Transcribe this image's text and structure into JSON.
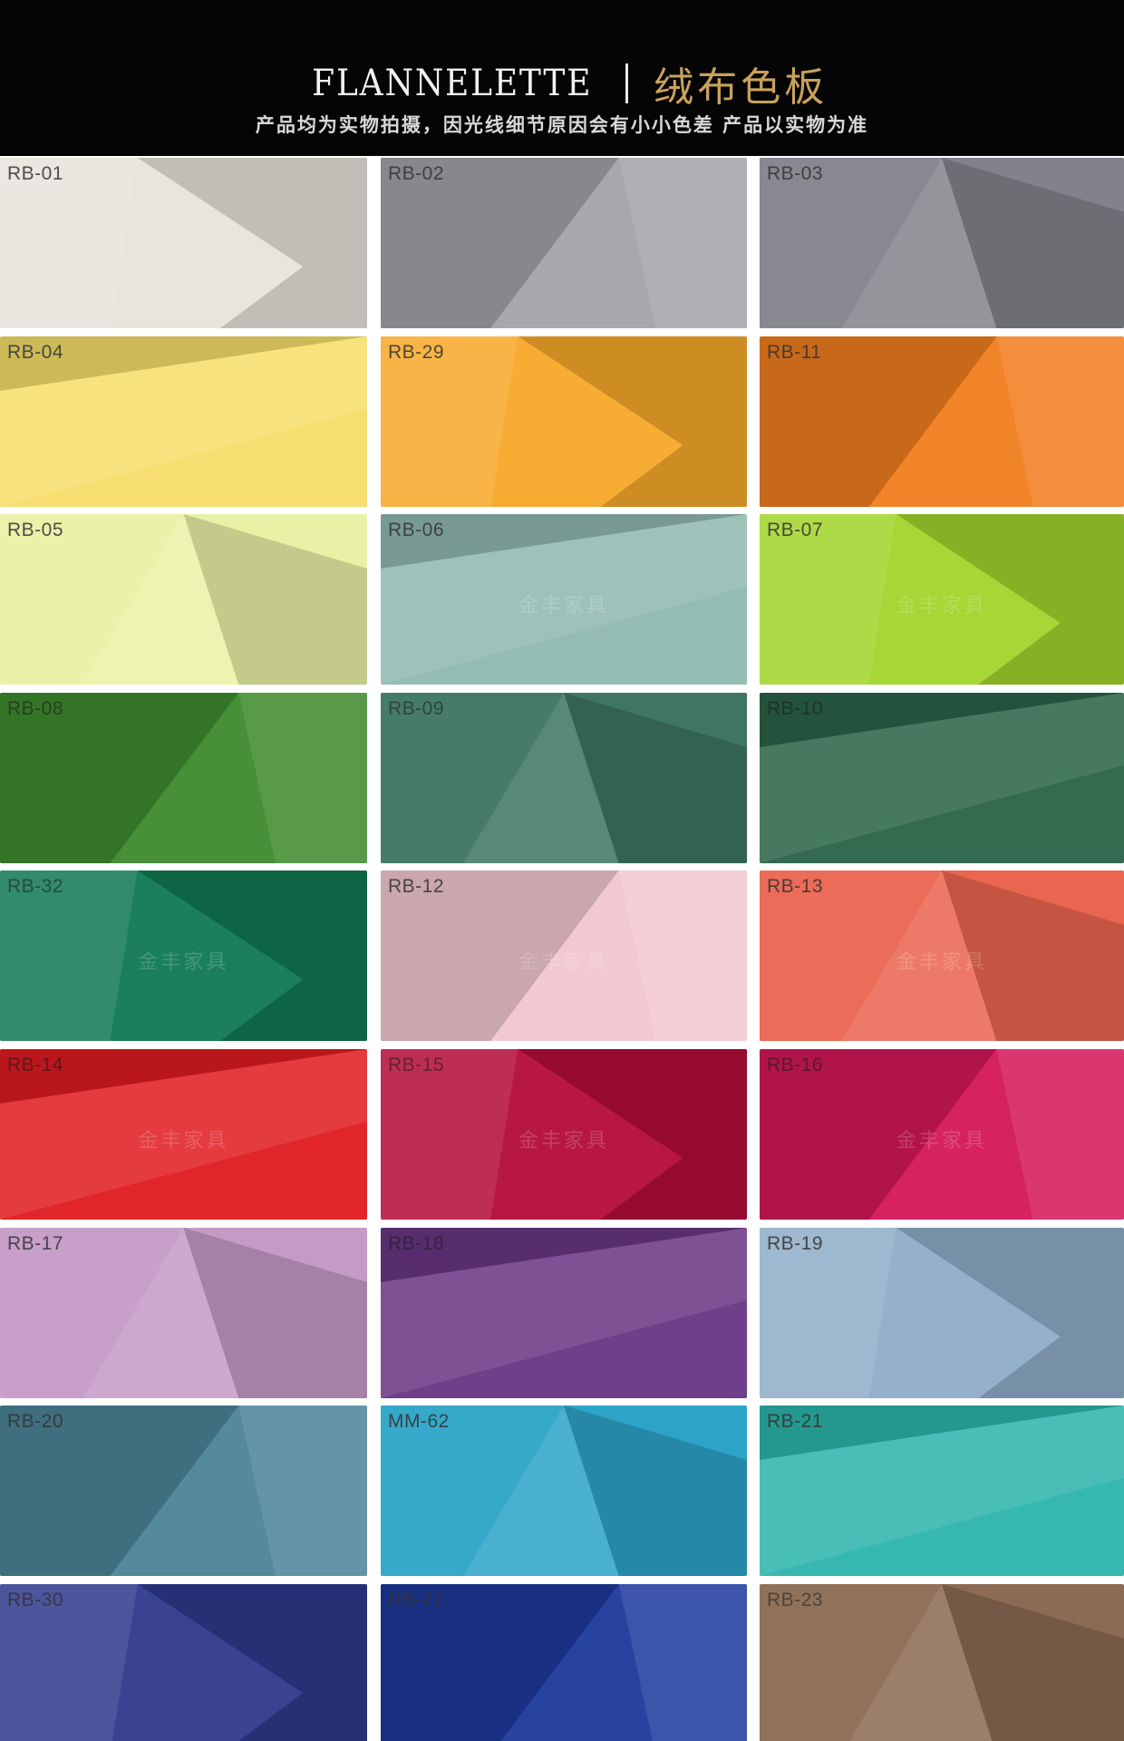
{
  "header": {
    "title_en": "FLANNELETTE",
    "title_cn": "绒布色板",
    "subtitle": "产品均为实物拍摄，因光线细节原因会有小小色差  产品以实物为准"
  },
  "watermark_text": "金丰家具",
  "swatches": [
    {
      "code": "RB-01",
      "color": "#e7e3dc",
      "dark": false,
      "watermark": false
    },
    {
      "code": "RB-02",
      "color": "#a3a2a7",
      "dark": false,
      "watermark": false
    },
    {
      "code": "RB-03",
      "color": "#82828a",
      "dark": false,
      "watermark": false
    },
    {
      "code": "RB-04",
      "color": "#f5dd6a",
      "dark": false,
      "watermark": false
    },
    {
      "code": "RB-29",
      "color": "#f6a92a",
      "dark": false,
      "watermark": false
    },
    {
      "code": "RB-11",
      "color": "#f07d1f",
      "dark": false,
      "watermark": false
    },
    {
      "code": "RB-05",
      "color": "#e9f1a6",
      "dark": false,
      "watermark": false
    },
    {
      "code": "RB-06",
      "color": "#8fb9b0",
      "dark": false,
      "watermark": true
    },
    {
      "code": "RB-07",
      "color": "#a2d42c",
      "dark": false,
      "watermark": true
    },
    {
      "code": "RB-08",
      "color": "#3f8a2e",
      "dark": true,
      "watermark": false
    },
    {
      "code": "RB-09",
      "color": "#3e7662",
      "dark": true,
      "watermark": false
    },
    {
      "code": "RB-10",
      "color": "#2b6448",
      "dark": true,
      "watermark": false
    },
    {
      "code": "RB-32",
      "color": "#117a55",
      "dark": true,
      "watermark": true
    },
    {
      "code": "RB-12",
      "color": "#f1c7d0",
      "dark": false,
      "watermark": true
    },
    {
      "code": "RB-13",
      "color": "#ea6650",
      "dark": false,
      "watermark": true
    },
    {
      "code": "RB-14",
      "color": "#df1c22",
      "dark": true,
      "watermark": true
    },
    {
      "code": "RB-15",
      "color": "#b40c3b",
      "dark": true,
      "watermark": true
    },
    {
      "code": "RB-16",
      "color": "#d4185a",
      "dark": true,
      "watermark": true
    },
    {
      "code": "RB-17",
      "color": "#c49ac6",
      "dark": false,
      "watermark": false
    },
    {
      "code": "RB-18",
      "color": "#6a3784",
      "dark": true,
      "watermark": false
    },
    {
      "code": "RB-19",
      "color": "#8fadc8",
      "dark": false,
      "watermark": false
    },
    {
      "code": "RB-20",
      "color": "#4c8598",
      "dark": false,
      "watermark": false
    },
    {
      "code": "MM-62",
      "color": "#2da3c8",
      "dark": false,
      "watermark": false
    },
    {
      "code": "RB-21",
      "color": "#2cb5ac",
      "dark": false,
      "watermark": false
    },
    {
      "code": "RB-30",
      "color": "#313b8c",
      "dark": false,
      "watermark": false
    },
    {
      "code": "RB-22",
      "color": "#1f3a9c",
      "dark": false,
      "watermark": false
    },
    {
      "code": "RB-23",
      "color": "#8b6b54",
      "dark": true,
      "watermark": false
    }
  ]
}
